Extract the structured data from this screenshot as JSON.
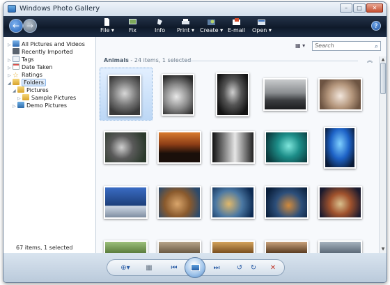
{
  "window": {
    "title": "Windows Photo Gallery"
  },
  "toolbar": {
    "file": "File",
    "fix": "Fix",
    "info": "Info",
    "print": "Print",
    "create": "Create",
    "email": "E-mail",
    "open": "Open",
    "help": "?"
  },
  "nav": {
    "items": [
      {
        "label": "All Pictures and Videos"
      },
      {
        "label": "Recently Imported"
      },
      {
        "label": "Tags"
      },
      {
        "label": "Date Taken"
      },
      {
        "label": "Ratings"
      },
      {
        "label": "Folders"
      },
      {
        "label": "Pictures"
      },
      {
        "label": "Sample Pictures"
      },
      {
        "label": "Demo Pictures"
      }
    ],
    "status": "67 items, 1 selected"
  },
  "search": {
    "placeholder": "Search"
  },
  "group": {
    "name": "Animals",
    "summary": "- 24 items, 1 selected"
  },
  "colors": {
    "toolbar": "#16243a",
    "selection": "#cfe3fa",
    "accent": "#2c5ea6"
  },
  "icons": [
    "back-arrow-icon",
    "forward-arrow-icon",
    "search-icon",
    "zoom-icon",
    "previous-icon",
    "next-icon",
    "rotate-left-icon",
    "rotate-right-icon",
    "delete-icon",
    "slideshow-icon"
  ]
}
